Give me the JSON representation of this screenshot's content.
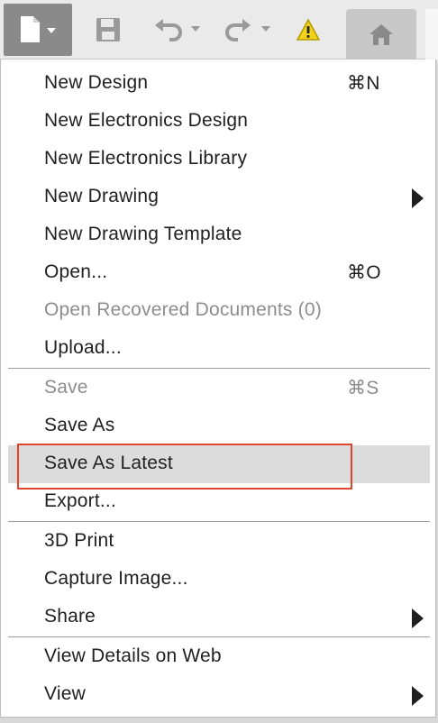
{
  "toolbar": {
    "icons": [
      "document-icon",
      "chevron-down-icon",
      "save-icon",
      "undo-icon",
      "redo-icon",
      "warning-icon",
      "home-icon"
    ]
  },
  "menu": {
    "groups": [
      [
        {
          "label": "New Design",
          "shortcut": "⌘N",
          "submenu": false,
          "disabled": false
        },
        {
          "label": "New Electronics Design",
          "shortcut": "",
          "submenu": false,
          "disabled": false
        },
        {
          "label": "New Electronics Library",
          "shortcut": "",
          "submenu": false,
          "disabled": false
        },
        {
          "label": "New Drawing",
          "shortcut": "",
          "submenu": true,
          "disabled": false
        },
        {
          "label": "New Drawing Template",
          "shortcut": "",
          "submenu": false,
          "disabled": false
        },
        {
          "label": "Open...",
          "shortcut": "⌘O",
          "submenu": false,
          "disabled": false
        },
        {
          "label": "Open Recovered Documents (0)",
          "shortcut": "",
          "submenu": false,
          "disabled": true
        },
        {
          "label": "Upload...",
          "shortcut": "",
          "submenu": false,
          "disabled": false
        }
      ],
      [
        {
          "label": "Save",
          "shortcut": "⌘S",
          "submenu": false,
          "disabled": true
        },
        {
          "label": "Save As",
          "shortcut": "",
          "submenu": false,
          "disabled": false
        },
        {
          "label": "Save As Latest",
          "shortcut": "",
          "submenu": false,
          "disabled": false,
          "highlighted": true
        },
        {
          "label": "Export...",
          "shortcut": "",
          "submenu": false,
          "disabled": false
        }
      ],
      [
        {
          "label": "3D Print",
          "shortcut": "",
          "submenu": false,
          "disabled": false
        },
        {
          "label": "Capture Image...",
          "shortcut": "",
          "submenu": false,
          "disabled": false
        },
        {
          "label": "Share",
          "shortcut": "",
          "submenu": true,
          "disabled": false
        }
      ],
      [
        {
          "label": "View Details on Web",
          "shortcut": "",
          "submenu": false,
          "disabled": false
        },
        {
          "label": "View",
          "shortcut": "",
          "submenu": true,
          "disabled": false
        }
      ]
    ]
  },
  "colors": {
    "highlight": "#dcdcdc",
    "focus_outline": "#e0452c",
    "warning": "#f2d21b",
    "disabled_text": "#8d8d8d"
  }
}
